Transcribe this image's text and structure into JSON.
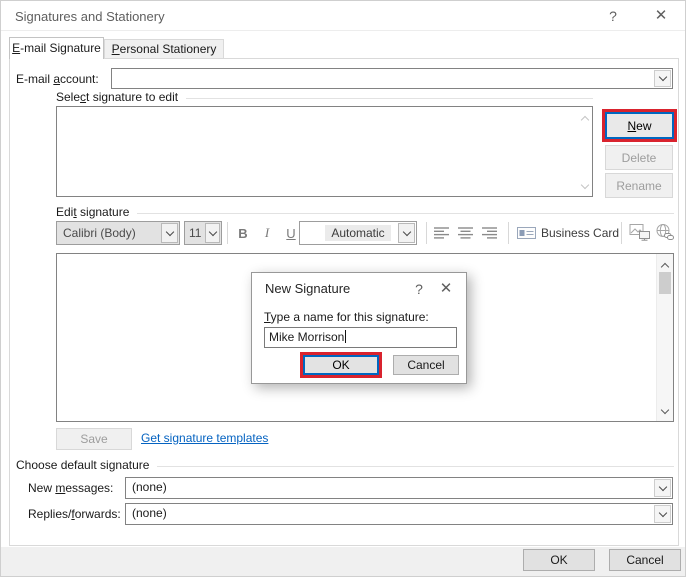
{
  "window": {
    "title": "Signatures and Stationery",
    "help": "?",
    "close": "✕"
  },
  "tabs": {
    "email_signature": {
      "key": "E",
      "rest": "-mail Signature"
    },
    "personal_stationery": {
      "key": "P",
      "rest": "ersonal Stationery"
    }
  },
  "email_account": {
    "label_pre": "E-mail ",
    "label_key": "a",
    "label_rest": "ccount:",
    "value": ""
  },
  "signature_list": {
    "header_pre": "Sele",
    "header_key": "c",
    "header_rest": "t signature to edit",
    "items": []
  },
  "signature_buttons": {
    "new_key": "N",
    "new_rest": "ew",
    "delete": "Delete",
    "rename": "Rename"
  },
  "edit_signature": {
    "header_pre": "Edi",
    "header_key": "t",
    "header_rest": " signature",
    "font_name": "Calibri (Body)",
    "font_size": "11",
    "bold": "B",
    "italic": "I",
    "underline": "U",
    "font_color": "Automatic",
    "business_card": "Business Card",
    "content": "",
    "save": "Save",
    "templates_link": "Get signature templates"
  },
  "defaults": {
    "header": "Choose default signature",
    "new_messages_pre": "New ",
    "new_messages_key": "m",
    "new_messages_rest": "essages:",
    "new_messages_value": "(none)",
    "replies_pre": "Replies/",
    "replies_key": "f",
    "replies_rest": "orwards:",
    "replies_value": "(none)"
  },
  "footer": {
    "ok": "OK",
    "cancel": "Cancel"
  },
  "popup": {
    "title": "New Signature",
    "help": "?",
    "close": "✕",
    "label_key": "T",
    "label_rest": "ype a name for this signature:",
    "name_value": "Mike Morrison",
    "ok": "OK",
    "cancel": "Cancel"
  },
  "colors": {
    "annotation_red": "#d9232e",
    "focus_blue": "#0067c0",
    "link_blue": "#0563c1"
  }
}
